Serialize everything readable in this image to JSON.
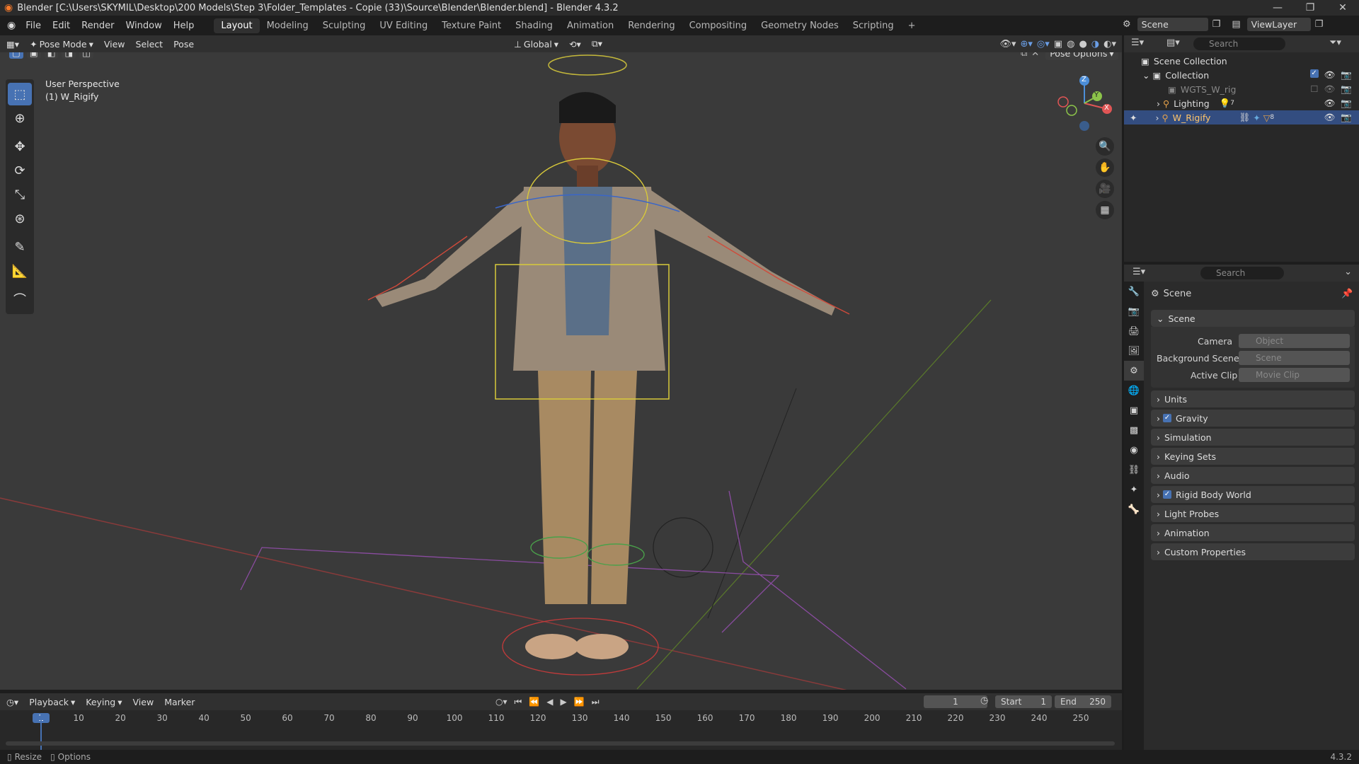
{
  "window": {
    "title": "Blender [C:\\Users\\SKYMIL\\Desktop\\200 Models\\Step 3\\Folder_Templates - Copie (33)\\Source\\Blender\\Blender.blend] - Blender 4.3.2"
  },
  "menu": [
    "File",
    "Edit",
    "Render",
    "Window",
    "Help"
  ],
  "workspaces": [
    "Layout",
    "Modeling",
    "Sculpting",
    "UV Editing",
    "Texture Paint",
    "Shading",
    "Animation",
    "Rendering",
    "Compositing",
    "Geometry Nodes",
    "Scripting"
  ],
  "top_right": {
    "scene": "Scene",
    "view_layer": "ViewLayer"
  },
  "viewport_header": {
    "mode": "Pose Mode",
    "view": "View",
    "select": "Select",
    "pose": "Pose",
    "orientation": "Global",
    "pose_options": "Pose Options"
  },
  "viewport": {
    "perspective": "User Perspective",
    "object": "(1) W_Rigify"
  },
  "gizmo": {
    "x": "X",
    "y": "Y",
    "z": "Z"
  },
  "outliner": {
    "search_placeholder": "Search",
    "scene_collection": "Scene Collection",
    "items": [
      {
        "label": "Collection"
      },
      {
        "label": "WGTS_W_rig"
      },
      {
        "label": "Lighting",
        "count": "7"
      },
      {
        "label": "W_Rigify",
        "count": "8"
      }
    ]
  },
  "properties": {
    "search_placeholder": "Search",
    "context": "Scene",
    "section": "Scene",
    "camera_label": "Camera",
    "camera_placeholder": "Object",
    "bg_scene_label": "Background Scene",
    "bg_scene_placeholder": "Scene",
    "active_clip_label": "Active Clip",
    "active_clip_placeholder": "Movie Clip",
    "panels": [
      "Units",
      "Gravity",
      "Simulation",
      "Keying Sets",
      "Audio",
      "Rigid Body World",
      "Light Probes",
      "Animation",
      "Custom Properties"
    ]
  },
  "timeline": {
    "playback": "Playback",
    "keying": "Keying",
    "view": "View",
    "marker": "Marker",
    "current_frame": "1",
    "start_label": "Start",
    "start": "1",
    "end_label": "End",
    "end": "250",
    "ticks": [
      "1",
      "10",
      "20",
      "30",
      "40",
      "50",
      "60",
      "70",
      "80",
      "90",
      "100",
      "110",
      "120",
      "130",
      "140",
      "150",
      "160",
      "170",
      "180",
      "190",
      "200",
      "210",
      "220",
      "230",
      "240",
      "250"
    ]
  },
  "statusbar": {
    "resize": "Resize",
    "options": "Options",
    "version": "4.3.2"
  },
  "colors": {
    "accent": "#4772b3",
    "selected_row": "#334d80",
    "x_axis": "#e05555",
    "y_axis": "#8cc44a",
    "z_axis": "#4c8ed8"
  }
}
